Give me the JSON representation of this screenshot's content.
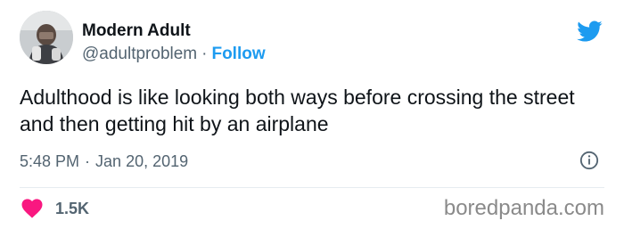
{
  "author": {
    "name": "Modern Adult",
    "handle": "@adultproblem",
    "separator": "·",
    "follow_label": "Follow",
    "avatar_icon": "profile-photo"
  },
  "tweet": {
    "text": "Adulthood is like looking both ways before crossing the street and then getting hit by an airplane",
    "time": "5:48 PM",
    "separator": "·",
    "date": "Jan 20, 2019"
  },
  "engagement": {
    "like_count": "1.5K",
    "like_icon": "heart-icon"
  },
  "icons": {
    "brand": "twitter-bird-icon",
    "info": "info-icon"
  },
  "watermark": "boredpanda.com",
  "colors": {
    "accent": "#1d9bf0",
    "heart": "#f91880",
    "text": "#0f1419",
    "muted": "#536471"
  }
}
